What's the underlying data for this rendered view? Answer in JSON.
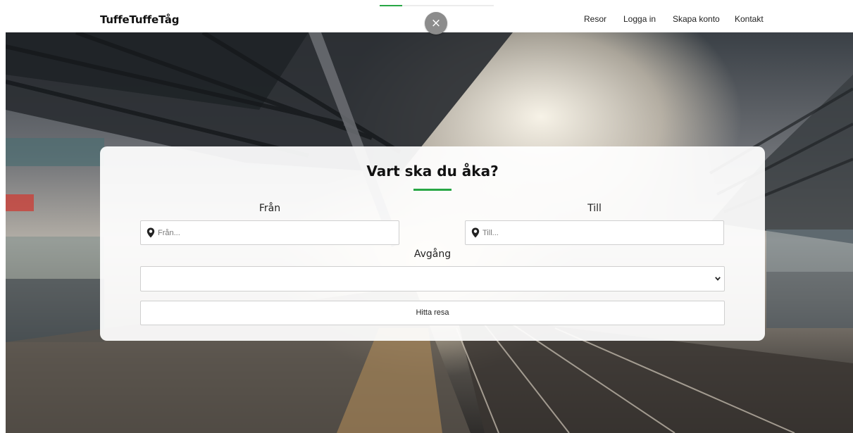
{
  "header": {
    "brand": "TuffeTuffeTåg",
    "close_icon": "×",
    "progress_fraction": 0.2,
    "nav": [
      {
        "label": "Resor"
      },
      {
        "label": "Logga in"
      },
      {
        "label": "Skapa konto"
      },
      {
        "label": "Kontakt"
      }
    ]
  },
  "search": {
    "title": "Vart ska du åka?",
    "from": {
      "label": "Från",
      "placeholder": "Från...",
      "value": "",
      "icon": "map-marker-icon"
    },
    "to": {
      "label": "Till",
      "placeholder": "Till...",
      "value": "",
      "icon": "map-marker-icon"
    },
    "departure": {
      "label": "Avgång",
      "selected": ""
    },
    "submit_label": "Hitta resa"
  },
  "colors": {
    "accent": "#28a745",
    "card_background": "#ffffff",
    "close_button": "#8c8c8c"
  }
}
